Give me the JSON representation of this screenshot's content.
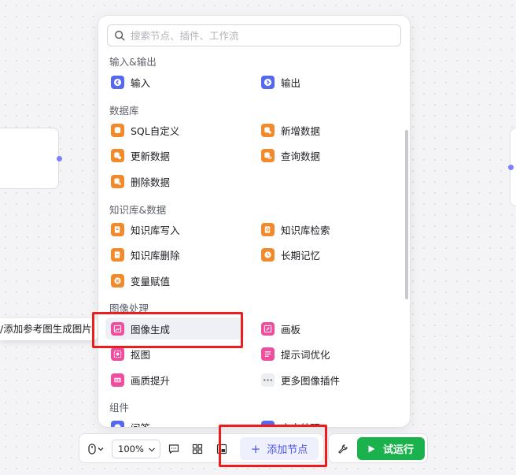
{
  "search": {
    "placeholder": "搜索节点、插件、工作流"
  },
  "sections": {
    "io": "输入&输出",
    "database": "数据库",
    "knowledge": "知识库&数据",
    "image": "图像处理",
    "components": "组件"
  },
  "items": {
    "input": "输入",
    "output": "输出",
    "sql_custom": "SQL自定义",
    "add_data": "新增数据",
    "update_data": "更新数据",
    "query_data": "查询数据",
    "delete_data": "删除数据",
    "kb_write": "知识库写入",
    "kb_search": "知识库检索",
    "kb_delete": "知识库删除",
    "long_memory": "长期记忆",
    "var_assign": "变量赋值",
    "image_gen": "图像生成",
    "canvas": "画板",
    "cutout": "抠图",
    "prompt_opt": "提示词优化",
    "quality_up": "画质提升",
    "more_image_plugins": "更多图像插件",
    "qa": "问答",
    "text_process": "文本处理"
  },
  "tooltip": {
    "text": "/添加参考图生成图片"
  },
  "toolbar": {
    "zoom": "100%",
    "add_node": "添加节点",
    "run": "试运行"
  },
  "colors": {
    "io_icon": "#5468f0",
    "db_icon": "#f28a2b",
    "image_icon": "#f04d9f",
    "run_button": "#1bb14d",
    "accent": "#4d53e8",
    "highlight_box": "#ee1c1c"
  }
}
